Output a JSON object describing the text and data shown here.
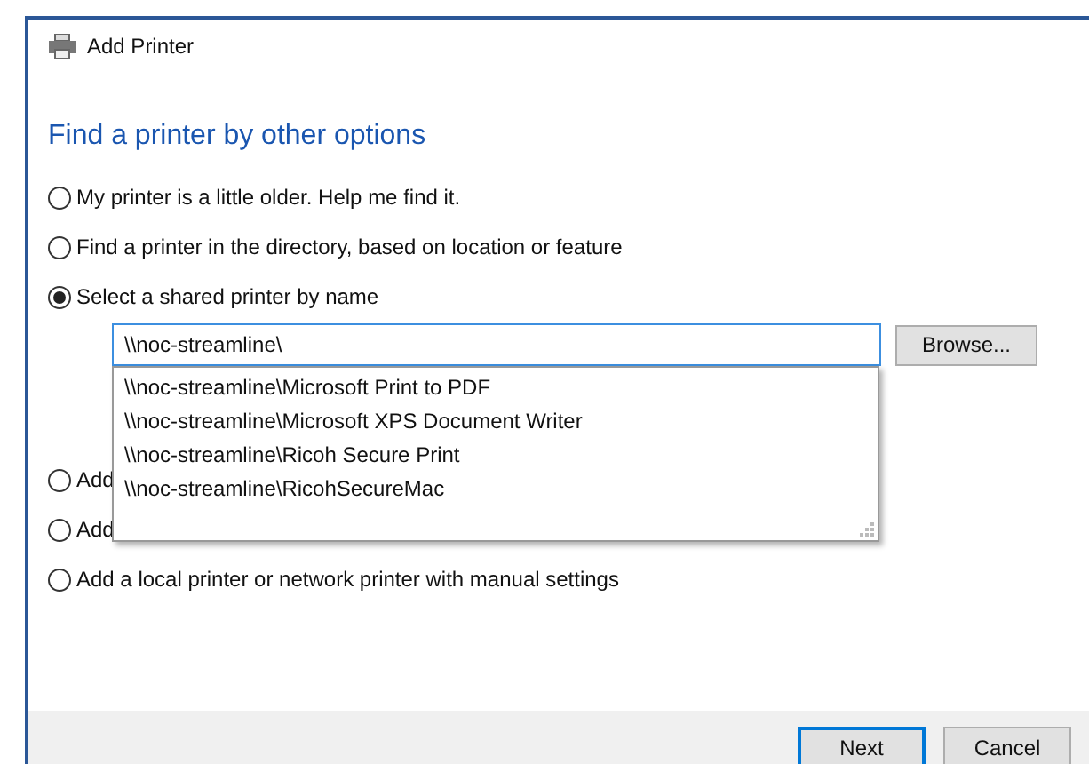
{
  "window": {
    "title": "Add Printer"
  },
  "heading": "Find a printer by other options",
  "options": [
    {
      "label": "My printer is a little older. Help me find it.",
      "selected": false
    },
    {
      "label": "Find a printer in the directory, based on location or feature",
      "selected": false
    },
    {
      "label": "Select a shared printer by name",
      "selected": true
    },
    {
      "label": "Add",
      "selected": false
    },
    {
      "label": "Add",
      "selected": false
    },
    {
      "label": "Add a local printer or network printer with manual settings",
      "selected": false
    }
  ],
  "name_field": {
    "value": "\\\\noc-streamline\\"
  },
  "browse_button": "Browse...",
  "suggestions": [
    "\\\\noc-streamline\\Microsoft Print to PDF",
    "\\\\noc-streamline\\Microsoft XPS Document Writer",
    "\\\\noc-streamline\\Ricoh Secure Print",
    "\\\\noc-streamline\\RicohSecureMac"
  ],
  "buttons": [
    {
      "label": "Next",
      "default": true
    },
    {
      "label": "Cancel",
      "default": false
    }
  ]
}
